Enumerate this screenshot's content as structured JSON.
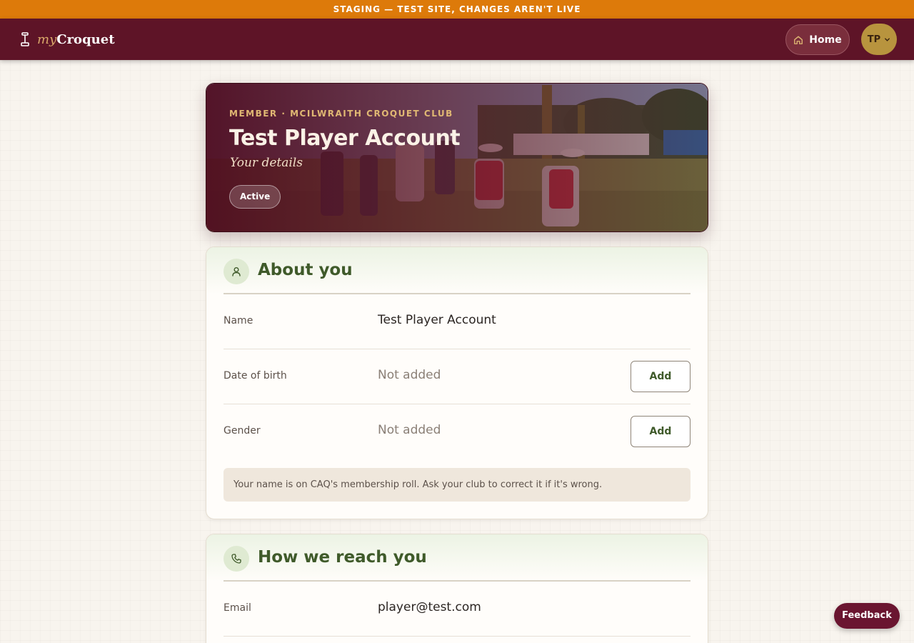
{
  "staging_banner": "STAGING — TEST SITE, CHANGES AREN'T LIVE",
  "brand": {
    "my": "my",
    "name": "Croquet"
  },
  "nav": {
    "home_label": "Home",
    "avatar_initials": "TP"
  },
  "hero": {
    "eyebrow": "MEMBER · MCILWRAITH CROQUET CLUB",
    "title": "Test Player Account",
    "subtitle": "Your details",
    "status": "Active"
  },
  "about": {
    "title": "About you",
    "rows": [
      {
        "label": "Name",
        "value": "Test Player Account",
        "action": ""
      },
      {
        "label": "Date of birth",
        "value": "Not added",
        "action": "Add"
      },
      {
        "label": "Gender",
        "value": "Not added",
        "action": "Add"
      }
    ],
    "note": "Your name is on CAQ's membership roll. Ask your club to correct it if it's wrong."
  },
  "reach": {
    "title": "How we reach you",
    "rows": [
      {
        "label": "Email",
        "value": "player@test.com"
      }
    ]
  },
  "feedback_label": "Feedback",
  "colors": {
    "banner": "#dd7a0a",
    "topbar": "#5e1427",
    "accent_green": "#3f5a2a",
    "avatar": "#b8943e"
  }
}
